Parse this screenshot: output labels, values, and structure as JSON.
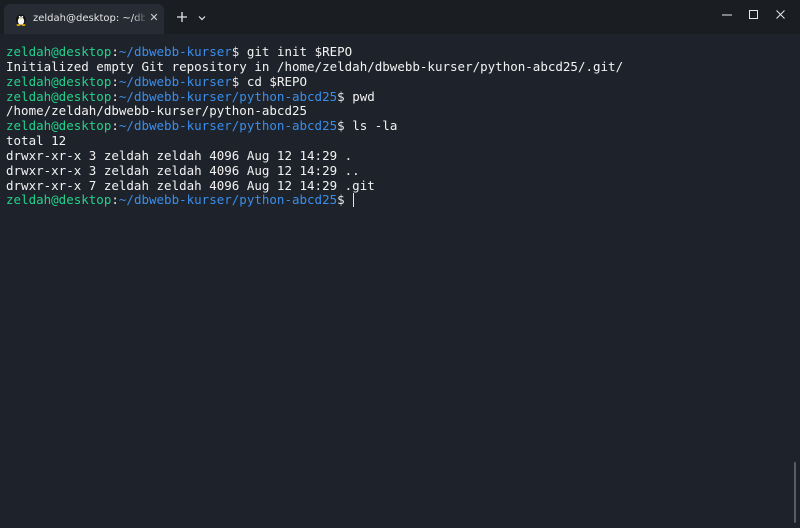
{
  "window": {
    "tab_title": "zeldah@desktop: ~/dbwebb-k",
    "tab_icon": "linux-penguin-icon",
    "new_tab_icon": "plus-icon",
    "dropdown_icon": "chevron-down-icon",
    "controls": [
      "minimize-icon",
      "maximize-icon",
      "close-icon"
    ]
  },
  "terminal": {
    "colors": {
      "background": "#1e222a",
      "user": "#23d18b",
      "path": "#3b8eea",
      "text": "#f2f2f2"
    },
    "lines": [
      {
        "type": "prompt",
        "user": "zeldah@desktop",
        "sep": ":",
        "path": "~/dbwebb-kurser",
        "dollar": "$",
        "command": " git init $REPO"
      },
      {
        "type": "output",
        "text": "Initialized empty Git repository in /home/zeldah/dbwebb-kurser/python-abcd25/.git/"
      },
      {
        "type": "prompt",
        "user": "zeldah@desktop",
        "sep": ":",
        "path": "~/dbwebb-kurser",
        "dollar": "$",
        "command": " cd $REPO"
      },
      {
        "type": "prompt",
        "user": "zeldah@desktop",
        "sep": ":",
        "path": "~/dbwebb-kurser/python-abcd25",
        "dollar": "$",
        "command": " pwd"
      },
      {
        "type": "output",
        "text": "/home/zeldah/dbwebb-kurser/python-abcd25"
      },
      {
        "type": "prompt",
        "user": "zeldah@desktop",
        "sep": ":",
        "path": "~/dbwebb-kurser/python-abcd25",
        "dollar": "$",
        "command": " ls -la"
      },
      {
        "type": "output",
        "text": "total 12"
      },
      {
        "type": "output",
        "text": "drwxr-xr-x 3 zeldah zeldah 4096 Aug 12 14:29 ."
      },
      {
        "type": "output",
        "text": "drwxr-xr-x 3 zeldah zeldah 4096 Aug 12 14:29 .."
      },
      {
        "type": "output",
        "text": "drwxr-xr-x 7 zeldah zeldah 4096 Aug 12 14:29 .git"
      },
      {
        "type": "prompt",
        "user": "zeldah@desktop",
        "sep": ":",
        "path": "~/dbwebb-kurser/python-abcd25",
        "dollar": "$",
        "command": " ",
        "cursor": true
      }
    ]
  }
}
